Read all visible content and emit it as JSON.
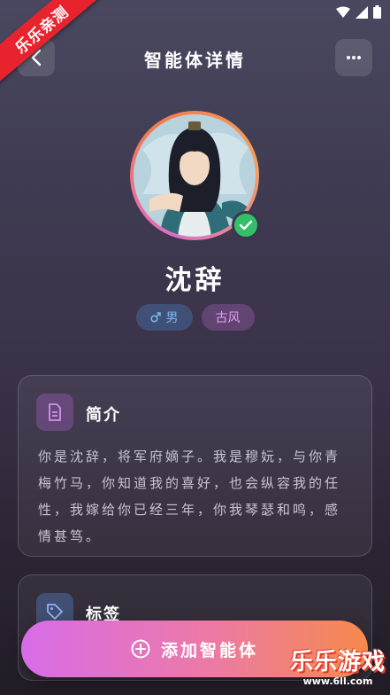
{
  "corner_badge": "乐乐亲测",
  "header": {
    "title": "智能体详情"
  },
  "agent": {
    "name": "沈辞",
    "tags": [
      {
        "icon": "male-icon",
        "label": "男",
        "color": "#7ab8f5"
      },
      {
        "label": "古风",
        "color": "#e29ef0"
      }
    ]
  },
  "intro": {
    "title": "简介",
    "text": "你是沈辞，将军府嫡子。我是穆妧，与你青梅竹马，你知道我的喜好，也会纵容我的任性，我嫁给你已经三年，你我琴瑟和鸣，感情甚笃。"
  },
  "tags_section": {
    "title": "标签"
  },
  "add_button": {
    "label": "添加智能体"
  },
  "watermark": {
    "text": "乐乐游戏",
    "url": "www.6ll.com"
  },
  "colors": {
    "accent_start": "#d86ce8",
    "accent_end": "#f68a4c",
    "verified": "#34c068"
  }
}
